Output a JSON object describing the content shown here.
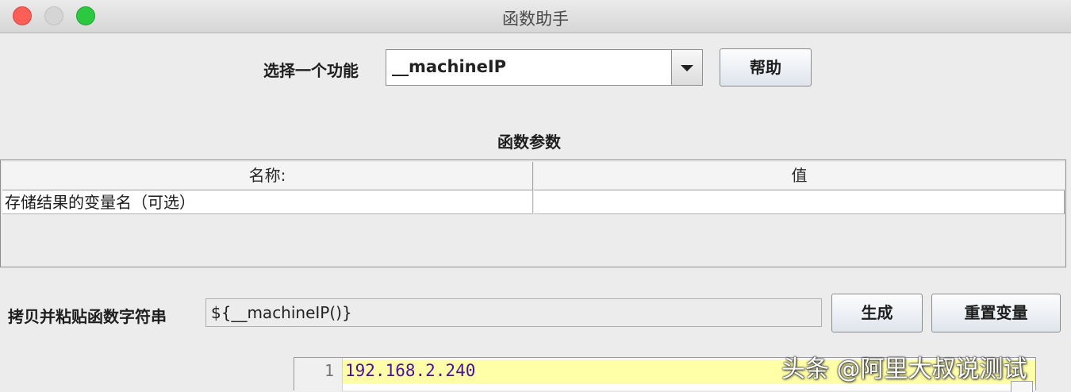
{
  "window": {
    "title": "函数助手"
  },
  "function_select": {
    "label": "选择一个功能",
    "selected": "__machineIP",
    "help_button": "帮助"
  },
  "params": {
    "section_title": "函数参数",
    "columns": [
      "名称:",
      "值"
    ],
    "rows": [
      {
        "name": "存储结果的变量名（可选）",
        "value": ""
      }
    ]
  },
  "function_string": {
    "label": "拷贝并粘贴函数字符串",
    "value": "${__machineIP()}",
    "generate_button": "生成",
    "reset_button": "重置变量"
  },
  "result": {
    "line_number": "1",
    "text": "192.168.2.240"
  },
  "watermark": "头条 @阿里大叔说测试"
}
